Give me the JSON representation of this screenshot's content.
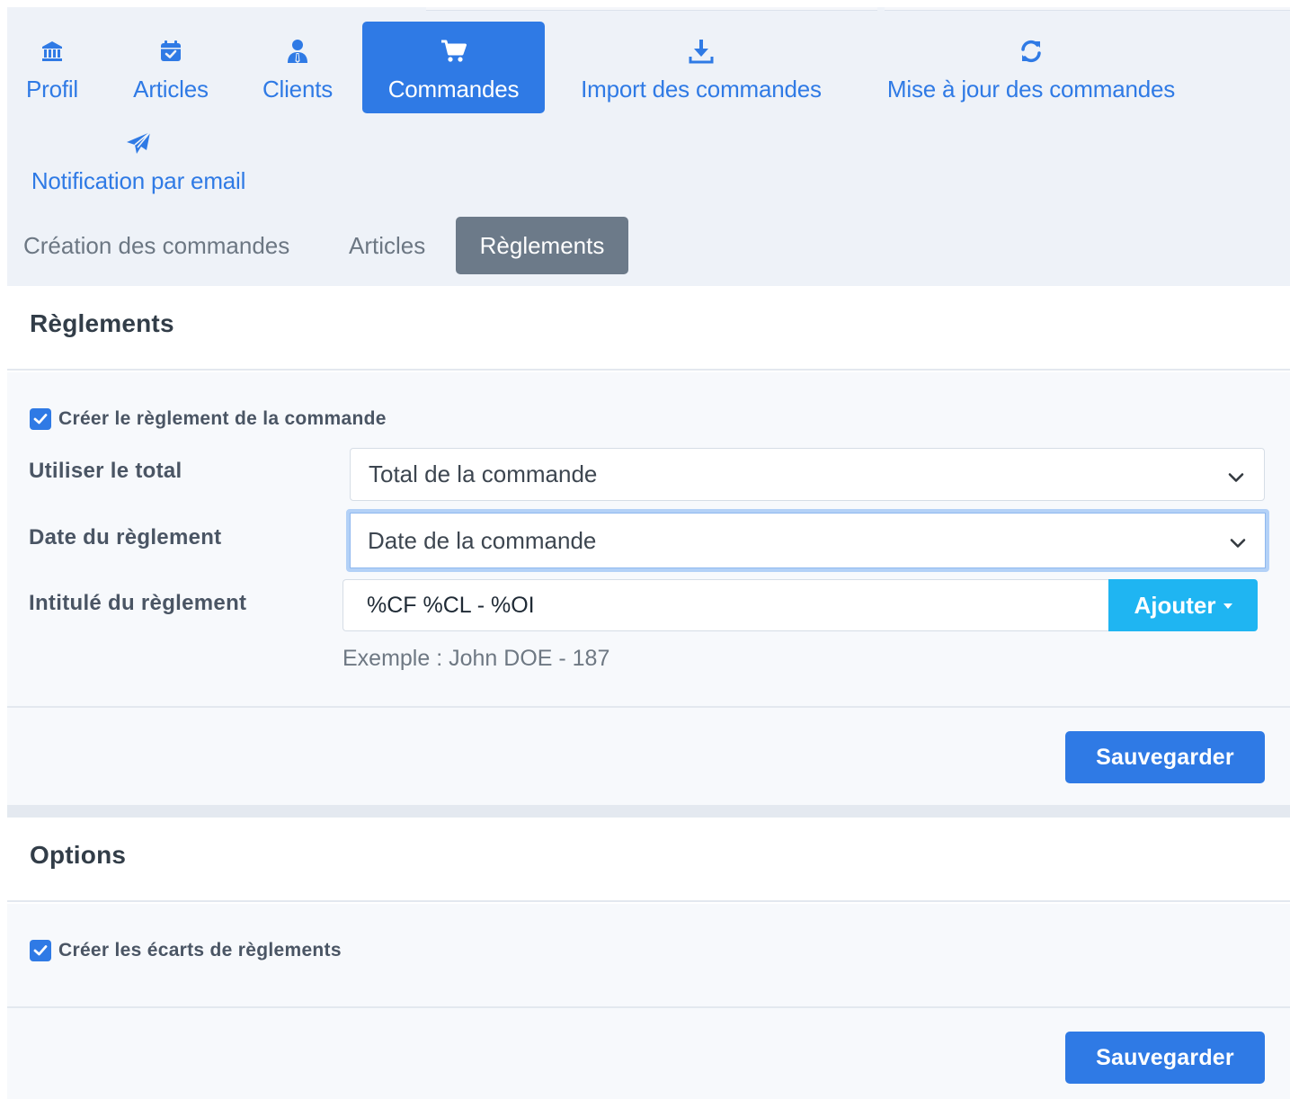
{
  "main_tabs": [
    {
      "label": "Profil",
      "icon": "bank-icon"
    },
    {
      "label": "Articles",
      "icon": "calendar-check-icon"
    },
    {
      "label": "Clients",
      "icon": "user-tie-icon"
    },
    {
      "label": "Commandes",
      "icon": "cart-icon",
      "active": true
    },
    {
      "label": "Import des commandes",
      "icon": "download-icon"
    },
    {
      "label": "Mise à jour des commandes",
      "icon": "refresh-icon"
    },
    {
      "label": "Notification par email",
      "icon": "paper-plane-icon"
    }
  ],
  "sub_tabs": [
    {
      "label": "Création des commandes"
    },
    {
      "label": "Articles"
    },
    {
      "label": "Règlements",
      "active": true
    }
  ],
  "reglements": {
    "title": "Règlements",
    "create_checkbox": {
      "label": "Créer le règlement de la commande",
      "checked": true
    },
    "total": {
      "label": "Utiliser le total",
      "value": "Total de la commande"
    },
    "date": {
      "label": "Date du règlement",
      "value": "Date de la commande"
    },
    "intitule": {
      "label": "Intitulé du règlement",
      "value": "%CF %CL - %OI",
      "button": "Ajouter"
    },
    "example": "Exemple : John DOE - 187",
    "save": "Sauvegarder"
  },
  "options": {
    "title": "Options",
    "ecarts_checkbox": {
      "label": "Créer les écarts de règlements",
      "checked": true
    },
    "save": "Sauvegarder"
  },
  "colors": {
    "primary": "#2f7ae5",
    "info": "#1fb5f2",
    "secondary": "#6c7a89",
    "nav_background": "#eef2f8"
  }
}
